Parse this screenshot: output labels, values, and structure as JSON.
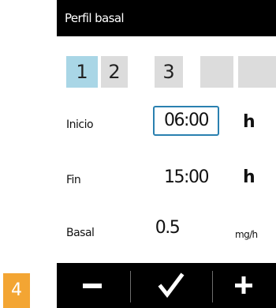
{
  "header": {
    "title": "Perfil basal"
  },
  "tabs": [
    {
      "label": "1",
      "active": true
    },
    {
      "label": "2",
      "active": false
    },
    {
      "label": "3",
      "active": false
    },
    {
      "label": "",
      "active": false
    },
    {
      "label": "",
      "active": false
    }
  ],
  "rows": [
    {
      "label": "Inicio",
      "value": "06:00",
      "unit": "h",
      "selected": true
    },
    {
      "label": "Fin",
      "value": "15:00",
      "unit": "h",
      "selected": false
    },
    {
      "label": "Basal",
      "value": "0.5",
      "unit": "mg/h",
      "selected": false
    }
  ],
  "actions": {
    "decrease_icon": "minus-icon",
    "confirm_icon": "check-icon",
    "increase_icon": "plus-icon"
  },
  "step_badge": "4",
  "colors": {
    "accent": "#f3a533",
    "active_tab": "#a9d6e6",
    "tab": "#dcdcdc",
    "selection_border": "#2a80b0",
    "background": "#000000"
  }
}
